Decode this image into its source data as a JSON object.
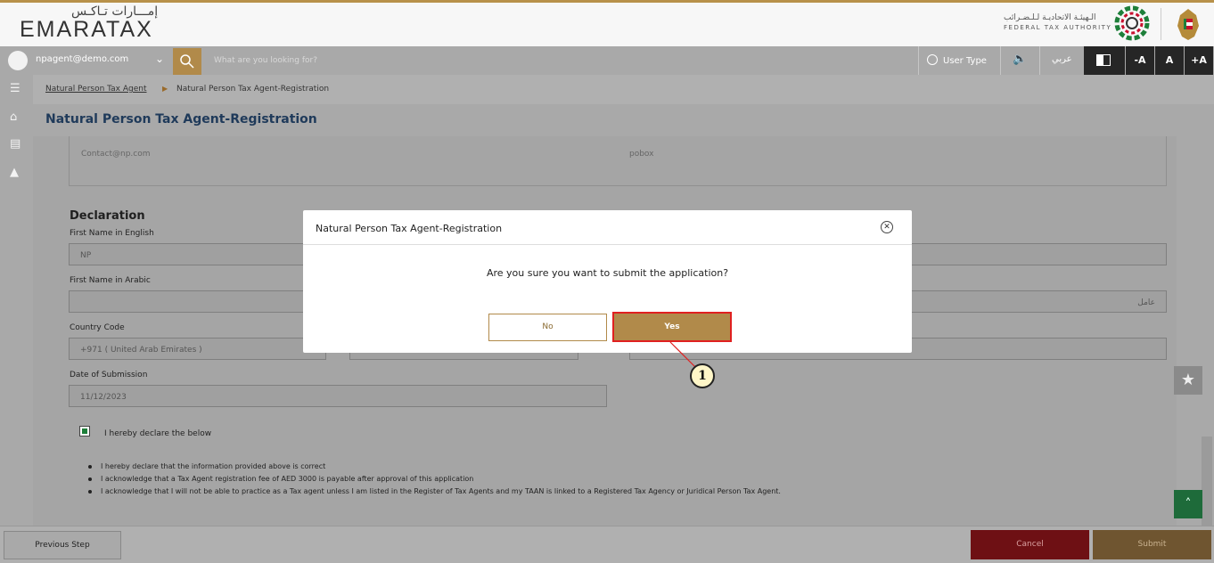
{
  "header": {
    "logo_ar": "إمـــارات تـاكـس",
    "logo_en": "EMARATAX",
    "fta_ar": "الـهيئـة الاتحاديـة لـلـضـرائب",
    "fta_en": "FEDERAL TAX AUTHORITY"
  },
  "toolbar": {
    "user_email": "npagent@demo.com",
    "search_placeholder": "What are you looking for?",
    "user_type_label": "User Type",
    "arabic_label": "عربي",
    "font_decrease": "-A",
    "font_normal": "A",
    "font_increase": "+A"
  },
  "breadcrumb": {
    "item1": "Natural Person Tax Agent",
    "item2": "Natural Person Tax Agent-Registration"
  },
  "page": {
    "title": "Natural Person Tax Agent-Registration"
  },
  "contact": {
    "email": "Contact@np.com",
    "pobox": "pobox"
  },
  "declaration": {
    "title": "Declaration",
    "first_name_en_label": "First Name in English",
    "first_name_en_value": "NP",
    "first_name_ar_label": "First Name in Arabic",
    "first_name_ar_value": "عامل",
    "country_code_label": "Country Code",
    "country_code_value": "+971 ( United Arab Emirates )",
    "date_label": "Date of Submission",
    "date_value": "11/12/2023",
    "checkbox_label": "I hereby declare the below",
    "bullets": [
      "I hereby declare that the information provided above is correct",
      "I acknowledge that a Tax Agent registration fee of AED 3000 is payable after approval of this application",
      "I acknowledge that I will not be able to practice as a Tax agent unless I am listed in the Register of Tax Agents and my TAAN is linked to a Registered Tax Agency or Juridical Person Tax Agent."
    ]
  },
  "footer": {
    "previous": "Previous Step",
    "cancel": "Cancel",
    "submit": "Submit"
  },
  "modal": {
    "title": "Natural Person Tax Agent-Registration",
    "message": "Are you sure you want to submit the application?",
    "no_label": "No",
    "yes_label": "Yes"
  },
  "annotation": {
    "step": "1"
  },
  "colors": {
    "accent_gold": "#b18a4a",
    "cancel_red": "#6e1014",
    "highlight_red": "#e02020",
    "title_navy": "#1f3a5a"
  }
}
